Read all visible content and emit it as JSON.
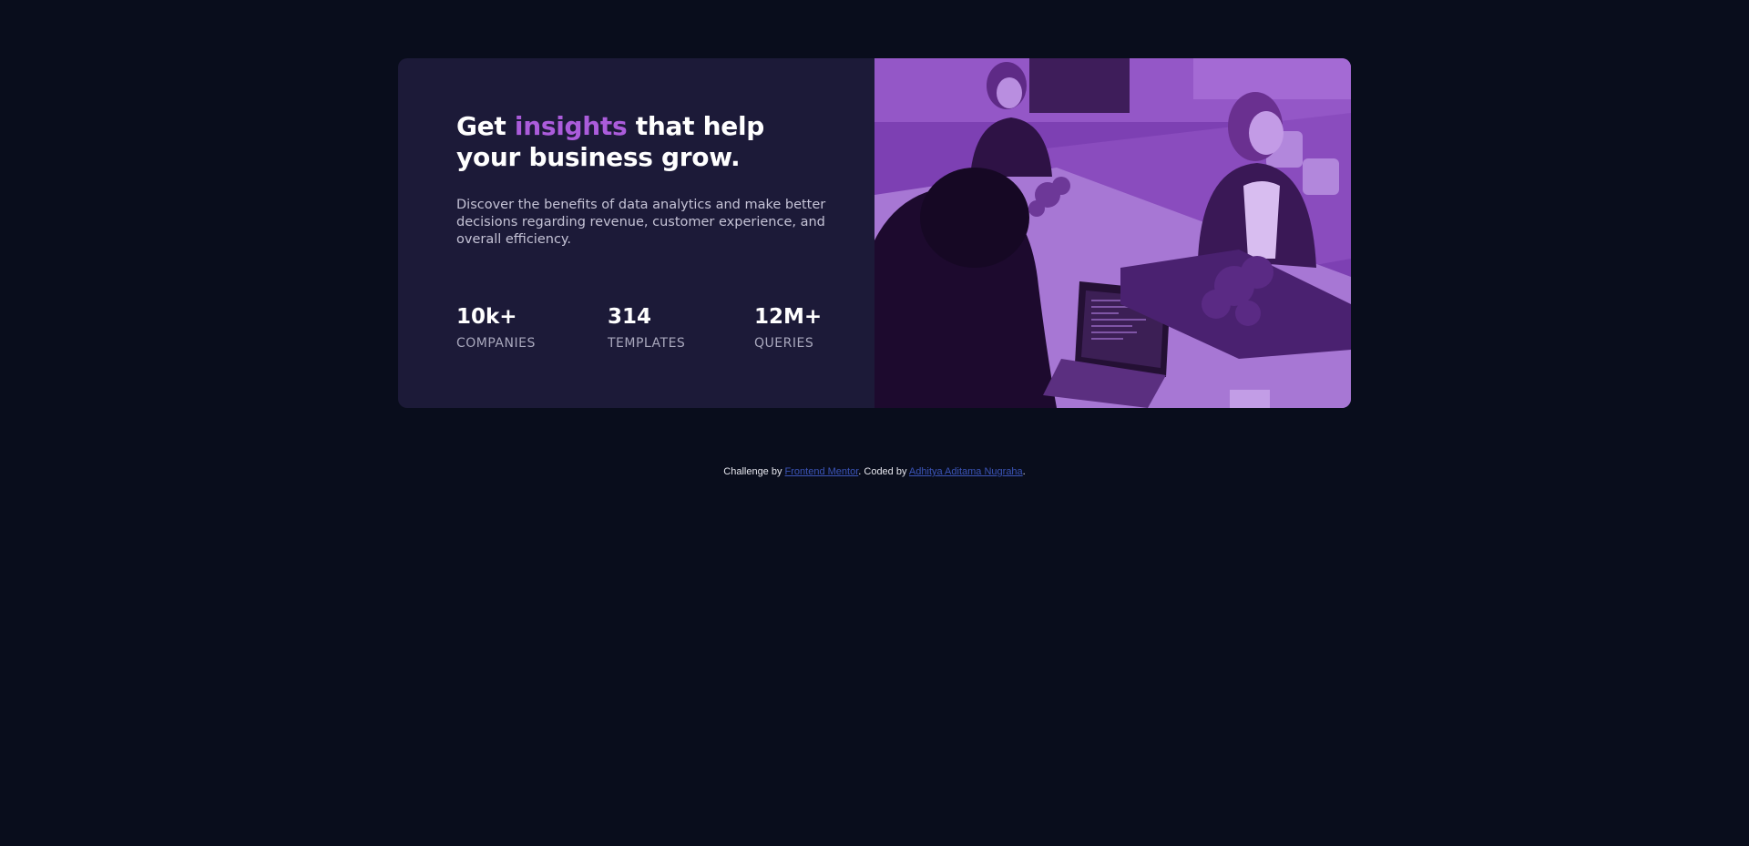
{
  "hero": {
    "title_part1": "Get ",
    "title_accent": "insights",
    "title_part2": " that help your business grow.",
    "description": "Discover the benefits of data analytics and make better decisions regarding revenue, customer experience, and overall efficiency."
  },
  "stats": [
    {
      "value": "10k+",
      "label": "COMPANIES"
    },
    {
      "value": "314",
      "label": "TEMPLATES"
    },
    {
      "value": "12M+",
      "label": "QUERIES"
    }
  ],
  "image": {
    "icon": "office-team-photo",
    "tint_color": "#aa5cdb"
  },
  "footer": {
    "prefix": "Challenge by ",
    "link1": "Frontend Mentor",
    "middle": ". Coded by ",
    "link2": "Adhitya Aditama Nugraha",
    "suffix": "."
  },
  "colors": {
    "background": "#090d1c",
    "card": "#1c1a38",
    "accent": "#ab5cdb",
    "link": "#3b54b7"
  }
}
